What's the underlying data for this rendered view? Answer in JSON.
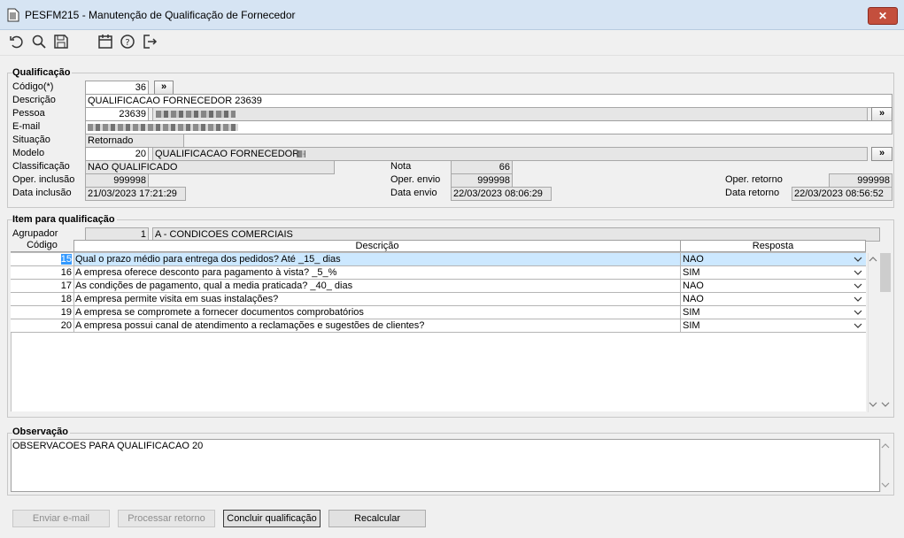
{
  "window": {
    "title": "PESFM215 - Manutenção de Qualificação de Fornecedor",
    "close_label": "✕"
  },
  "toolbar": {
    "icons": [
      "undo-icon",
      "search-icon",
      "save-icon",
      "calendar-icon",
      "help-icon",
      "exit-icon"
    ]
  },
  "qualificacao": {
    "legend": "Qualificação",
    "codigo_label": "Código(*)",
    "codigo_value": "36",
    "lookup_label": "»",
    "descricao_label": "Descrição",
    "descricao_value": "QUALIFICACAO FORNECEDOR 23639",
    "pessoa_label": "Pessoa",
    "pessoa_value": "23639",
    "email_label": "E-mail",
    "situacao_label": "Situação",
    "situacao_value": "Retornado",
    "modelo_label": "Modelo",
    "modelo_value": "20",
    "modelo_desc": "QUALIFICACAO FORNECEDOR - ",
    "classificacao_label": "Classificação",
    "classificacao_value": "NAO QUALIFICADO",
    "nota_label": "Nota",
    "nota_value": "66",
    "oper_inclusao_label": "Oper. inclusão",
    "oper_inclusao_value": "999998",
    "oper_envio_label": "Oper. envio",
    "oper_envio_value": "999998",
    "oper_retorno_label": "Oper. retorno",
    "oper_retorno_value": "999998",
    "data_inclusao_label": "Data inclusão",
    "data_inclusao_value": "21/03/2023 17:21:29",
    "data_envio_label": "Data envio",
    "data_envio_value": "22/03/2023 08:06:29",
    "data_retorno_label": "Data retorno",
    "data_retorno_value": "22/03/2023 08:56:52"
  },
  "itens": {
    "legend": "Item para qualificação",
    "agrupador_label": "Agrupador",
    "agrupador_value": "1",
    "agrupador_desc": "A - CONDICOES COMERCIAIS",
    "columns": [
      "Código",
      "Descrição",
      "Resposta"
    ],
    "rows": [
      {
        "codigo": "15",
        "descricao": "Qual o prazo médio para entrega dos pedidos? Até _15_ dias",
        "resposta": "NAO"
      },
      {
        "codigo": "16",
        "descricao": "A empresa oferece desconto para pagamento à vista? _5_%",
        "resposta": "SIM"
      },
      {
        "codigo": "17",
        "descricao": "As condições de pagamento, qual a media praticada? _40_ dias",
        "resposta": "NAO"
      },
      {
        "codigo": "18",
        "descricao": "A empresa permite visita em suas instalações?",
        "resposta": "NAO"
      },
      {
        "codigo": "19",
        "descricao": "A empresa se compromete a fornecer documentos comprobatórios",
        "resposta": "SIM"
      },
      {
        "codigo": "20",
        "descricao": "A empresa possui canal de atendimento a reclamações e sugestões de clientes?",
        "resposta": "SIM"
      }
    ]
  },
  "observacao": {
    "legend": "Observação",
    "value": "OBSERVACOES PARA QUALIFICACAO 20"
  },
  "buttons": {
    "enviar_email": "Enviar e-mail",
    "processar_retorno": "Processar retorno",
    "concluir": "Concluir qualificação",
    "recalcular": "Recalcular"
  }
}
